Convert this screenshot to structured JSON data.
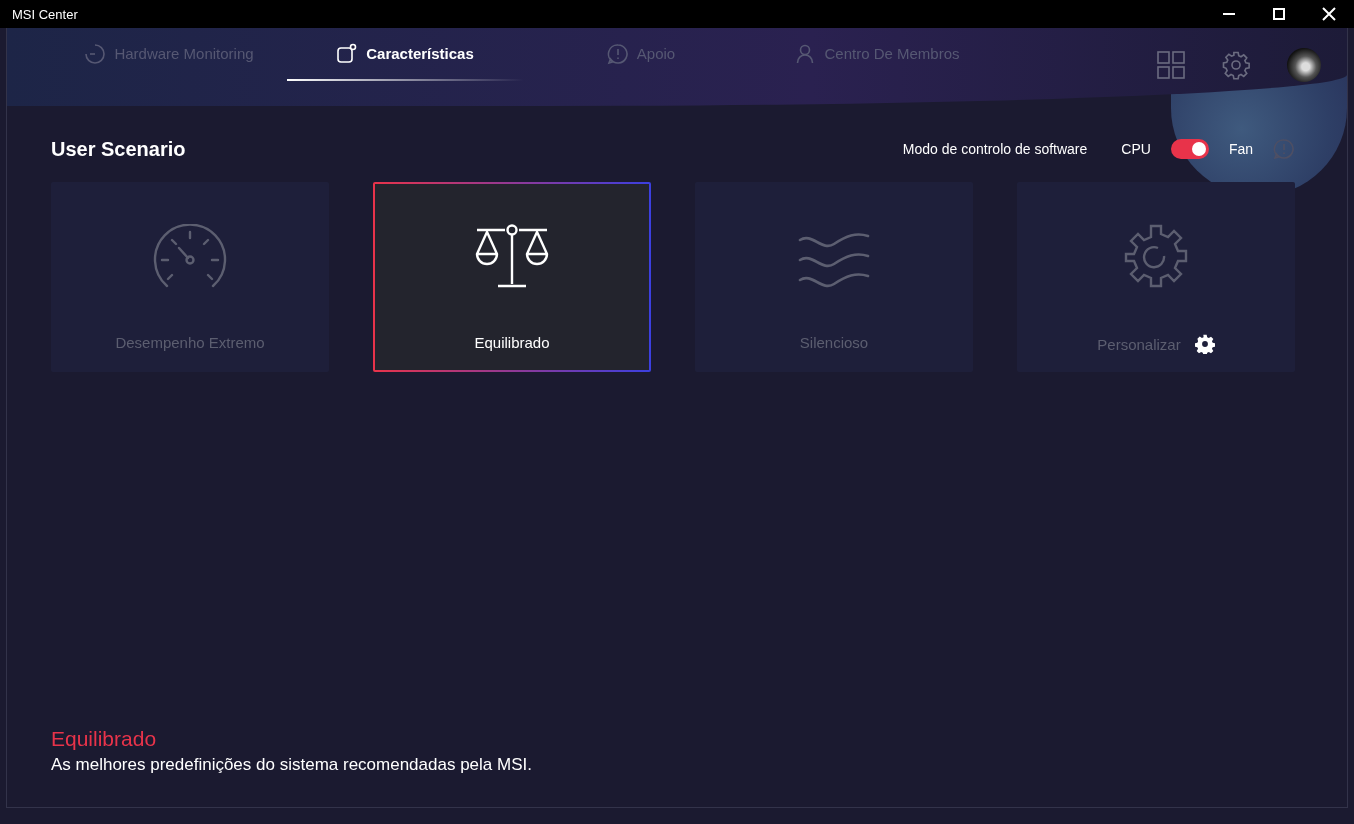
{
  "window": {
    "title": "MSI Center"
  },
  "tabs": [
    {
      "label": "Hardware Monitoring",
      "kind": "monitor",
      "selected": false
    },
    {
      "label": "Características",
      "kind": "features",
      "selected": true
    },
    {
      "label": "Apoio",
      "kind": "support",
      "selected": false
    },
    {
      "label": "Centro De Membros",
      "kind": "member",
      "selected": false
    }
  ],
  "page": {
    "title": "User Scenario",
    "control_mode": {
      "label": "Modo de controlo de software",
      "left": "CPU",
      "right": "Fan",
      "on": true
    }
  },
  "scenarios": [
    {
      "label": "Desempenho Extremo",
      "kind": "gauge",
      "selected": false,
      "settings": false
    },
    {
      "label": "Equilibrado",
      "kind": "scale",
      "selected": true,
      "settings": false
    },
    {
      "label": "Silencioso",
      "kind": "waves",
      "selected": false,
      "settings": false
    },
    {
      "label": "Personalizar",
      "kind": "gear",
      "selected": false,
      "settings": true
    }
  ],
  "description": {
    "title": "Equilibrado",
    "text": "As melhores predefinições do sistema recomendadas pela MSI."
  }
}
